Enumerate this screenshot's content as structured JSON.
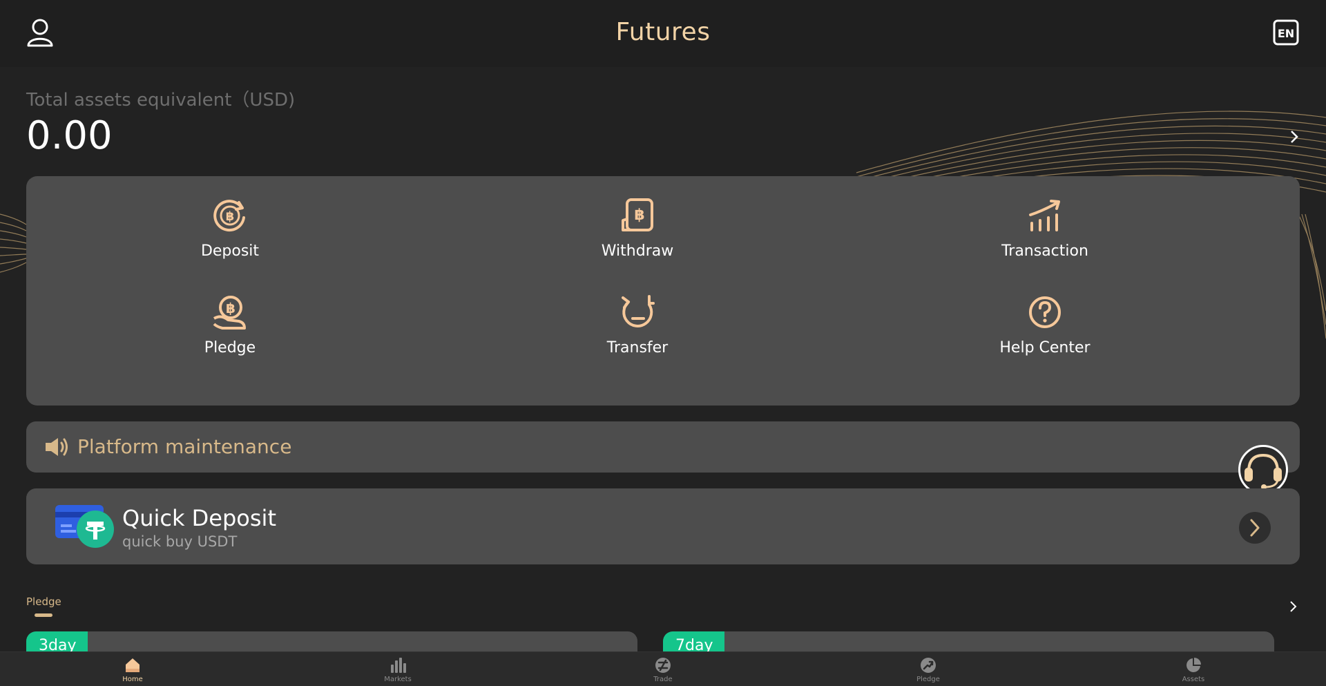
{
  "header": {
    "title": "Futures",
    "profile_icon": "user-icon",
    "language_label": "EN"
  },
  "assets": {
    "label": "Total assets equivalent（USD)",
    "value": "0.00"
  },
  "menu": {
    "items": [
      {
        "label": "Deposit",
        "icon": "bitcoin-refresh-icon"
      },
      {
        "label": "Withdraw",
        "icon": "bitcoin-receipt-icon"
      },
      {
        "label": "Transaction",
        "icon": "chart-up-icon"
      },
      {
        "label": "Pledge",
        "icon": "bitcoin-hand-icon"
      },
      {
        "label": "Transfer",
        "icon": "transfer-clock-icon"
      },
      {
        "label": "Help Center",
        "icon": "question-icon"
      }
    ]
  },
  "notice": {
    "text": "Platform maintenance"
  },
  "quick_deposit": {
    "title": "Quick Deposit",
    "subtitle": "quick buy USDT"
  },
  "pledge": {
    "label": "Pledge",
    "cards": [
      {
        "tag": "3day"
      },
      {
        "tag": "7day"
      }
    ]
  },
  "tabbar": {
    "items": [
      {
        "label": "Home",
        "active": true
      },
      {
        "label": "Markets",
        "active": false
      },
      {
        "label": "Trade",
        "active": false
      },
      {
        "label": "Pledge",
        "active": false
      },
      {
        "label": "Assets",
        "active": false
      }
    ]
  },
  "colors": {
    "accent_gold": "#f2d3a6",
    "icon_gold": "#f6c89a",
    "card_bg": "#4d4d4d",
    "page_bg": "#222222",
    "tag_green": "#15c58b"
  }
}
